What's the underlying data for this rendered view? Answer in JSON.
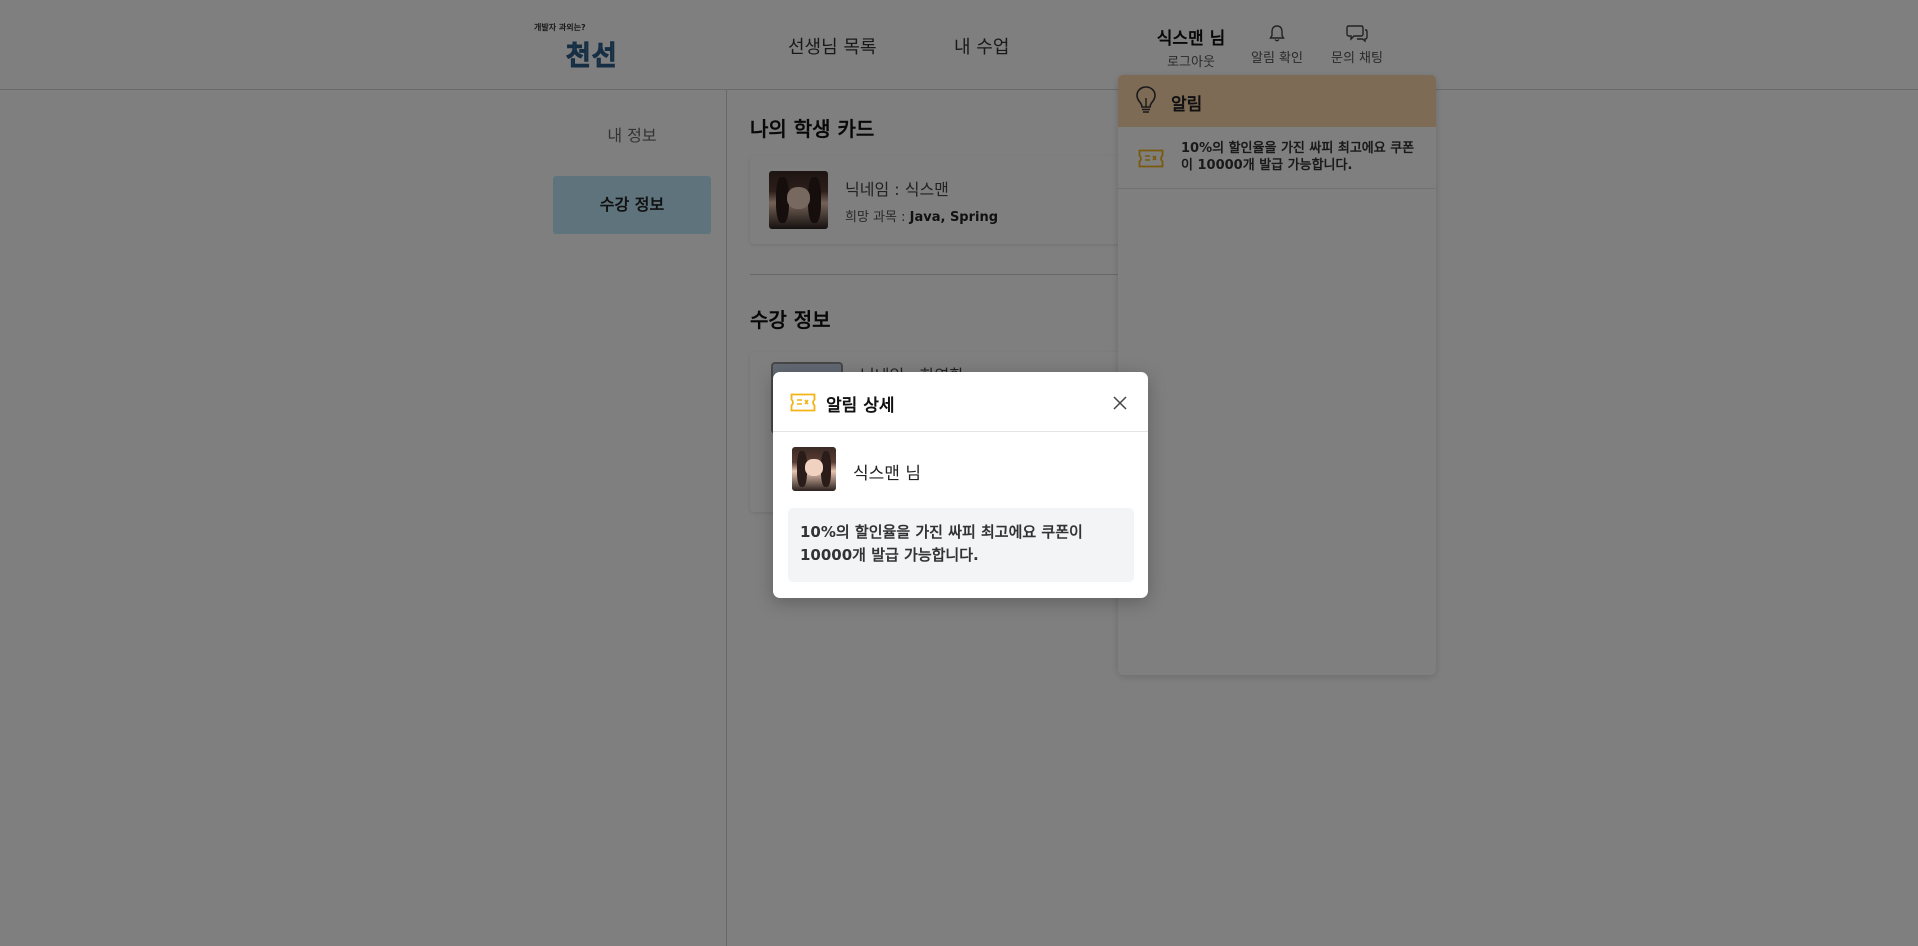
{
  "header": {
    "logo": {
      "small_text": "개발자 과외는?",
      "big_text": "천선"
    },
    "nav": {
      "teachers": "선생님 목록",
      "my_class": "내 수업"
    },
    "user": {
      "name": "식스맨 님",
      "logout": "로그아웃"
    },
    "alarm_label": "알림 확인",
    "chat_label": "문의 채팅"
  },
  "sidebar": {
    "my_info": "내 정보",
    "course_info": "수강 정보"
  },
  "main": {
    "student_card_title": "나의 학생 카드",
    "student_card": {
      "nickname": "닉네임 : 식스맨",
      "hope_label": "희망 과목 : ",
      "hope_value": "Java, Spring"
    },
    "course_title": "수강 정보",
    "course_card": {
      "nickname": "닉네임 : 한영환"
    }
  },
  "notification_panel": {
    "title": "알림",
    "items": [
      {
        "message": "10%의 할인율을 가진 싸피 최고에요 쿠폰이 10000개 발급 가능합니다."
      }
    ]
  },
  "modal": {
    "title": "알림 상세",
    "user_name": "식스맨 님",
    "message": "10%의 할인율을 가진 싸피 최고에요 쿠폰이 10000개 발급 가능합니다."
  },
  "colors": {
    "accent_ticket": "#f2b417",
    "notif_header": "#fbd6ac",
    "sidebar_active": "#bfe6fb"
  }
}
